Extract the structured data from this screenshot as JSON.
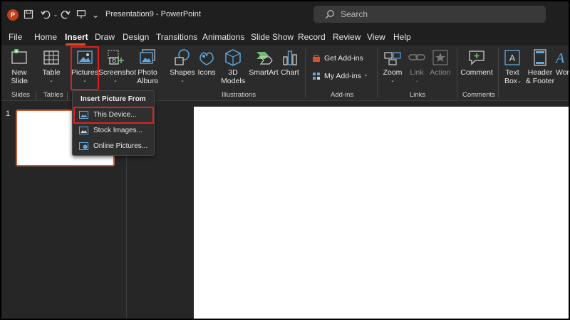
{
  "window": {
    "title": "Presentation9  -  PowerPoint",
    "logo": "P"
  },
  "search": {
    "placeholder": "Search"
  },
  "tabs": [
    "File",
    "Home",
    "Insert",
    "Draw",
    "Design",
    "Transitions",
    "Animations",
    "Slide Show",
    "Record",
    "Review",
    "View",
    "Help"
  ],
  "active_tab": "Insert",
  "ribbon": {
    "new_slide": [
      "New",
      "Slide"
    ],
    "table": "Table",
    "pictures": "Pictures",
    "screenshot": "Screenshot",
    "photo_album": [
      "Photo",
      "Album"
    ],
    "shapes": "Shapes",
    "icons": "Icons",
    "models_3d": [
      "3D",
      "Models"
    ],
    "smartart": "SmartArt",
    "chart": "Chart",
    "get_addins": "Get Add-ins",
    "my_addins": "My Add-ins",
    "zoom": "Zoom",
    "link": "Link",
    "action": "Action",
    "comment": "Comment",
    "text_box": [
      "Text",
      "Box"
    ],
    "header_footer": [
      "Header",
      "& Footer"
    ],
    "word": "Word",
    "groups": {
      "slides": "Slides",
      "tables": "Tables",
      "illustrations": "Illustrations",
      "addins": "Add-ins",
      "links": "Links",
      "comments": "Comments"
    }
  },
  "dropdown": {
    "heading": "Insert Picture From",
    "items": [
      "This Device...",
      "Stock Images...",
      "Online Pictures..."
    ]
  },
  "slide_panel": {
    "slide_number": "1"
  },
  "colors": {
    "accent": "#d35230",
    "highlight": "#e02020",
    "background": "#262626"
  }
}
